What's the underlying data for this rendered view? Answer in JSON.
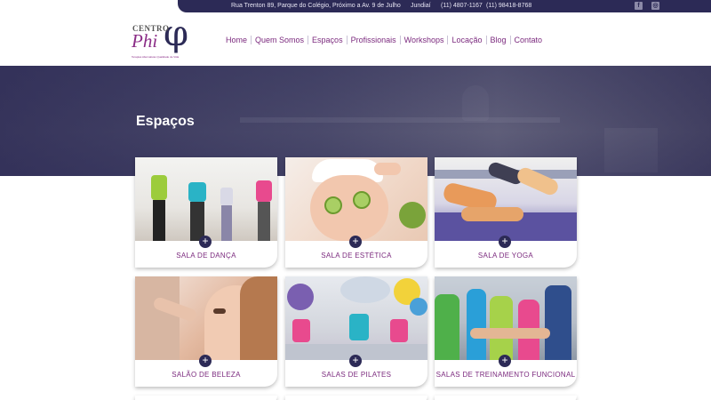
{
  "topbar": {
    "address": "Rua Trenton 89, Parque do Colégio, Próximo a Av. 9 de Julho",
    "city": "Jundiaí",
    "phone1": "(11) 4807-1167",
    "phone2": "(11) 98418-8768",
    "social": {
      "facebook": "f",
      "instagram": "◎"
    }
  },
  "logo": {
    "centro": "CENTRO",
    "phi": "Phi",
    "symbol": "φ",
    "tagline": "Terapias Alternativas Qualidade de Vida"
  },
  "nav": [
    "Home",
    "Quem Somos",
    "Espaços",
    "Profissionais",
    "Workshops",
    "Locação",
    "Blog",
    "Contato"
  ],
  "hero": {
    "title": "Espaços"
  },
  "cards": [
    {
      "label": "SALA DE DANÇA"
    },
    {
      "label": "SALA DE ESTÉTICA"
    },
    {
      "label": "SALA DE YOGA"
    },
    {
      "label": "SALÃO DE BELEZA"
    },
    {
      "label": "SALAS DE PILATES"
    },
    {
      "label": "SALAS DE TREINAMENTO FUNCIONAL"
    }
  ],
  "icons": {
    "plus": "+"
  },
  "colors": {
    "brand_dark": "#2c2a56",
    "brand_purple": "#7b2a7e"
  }
}
